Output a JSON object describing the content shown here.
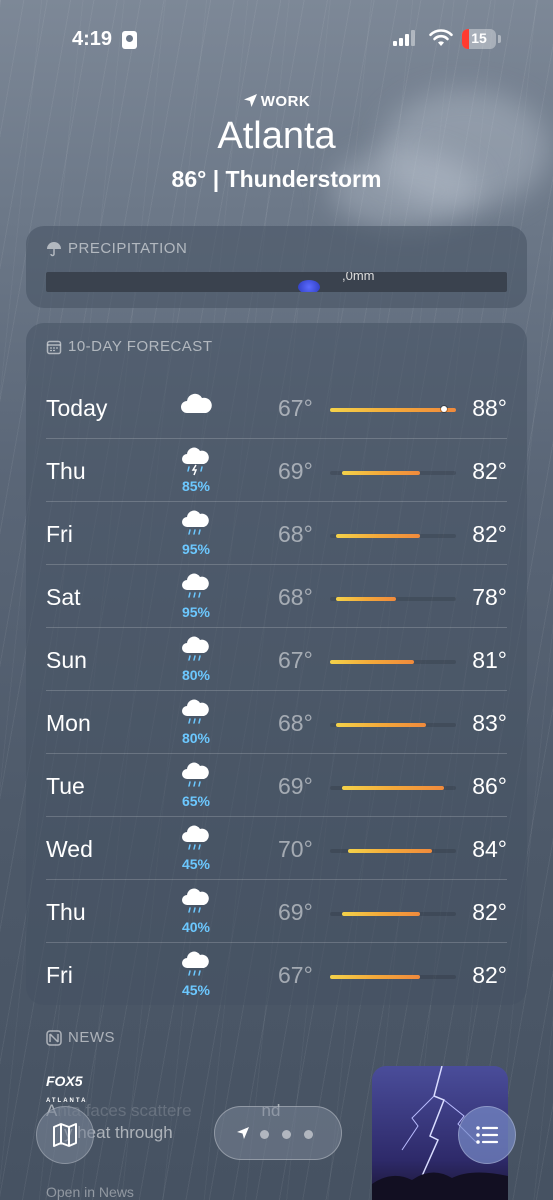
{
  "status_bar": {
    "time": "4:19",
    "battery": "15"
  },
  "header": {
    "location_tag": "WORK",
    "city": "Atlanta",
    "summary": "86°  |  Thunderstorm"
  },
  "precipitation": {
    "title": "PRECIPITATION",
    "map_label": ",0mm"
  },
  "forecast": {
    "title": "10-DAY FORECAST",
    "days": [
      {
        "day": "Today",
        "icon": "cloud-icon",
        "precip": "",
        "low": "67°",
        "high": "88°",
        "low_val": 67,
        "high_val": 88,
        "current_val": 86
      },
      {
        "day": "Thu",
        "icon": "thunderstorm-rain-icon",
        "precip": "85%",
        "low": "69°",
        "high": "82°",
        "low_val": 69,
        "high_val": 82
      },
      {
        "day": "Fri",
        "icon": "rain-icon",
        "precip": "95%",
        "low": "68°",
        "high": "82°",
        "low_val": 68,
        "high_val": 82
      },
      {
        "day": "Sat",
        "icon": "rain-icon",
        "precip": "95%",
        "low": "68°",
        "high": "78°",
        "low_val": 68,
        "high_val": 78
      },
      {
        "day": "Sun",
        "icon": "rain-icon",
        "precip": "80%",
        "low": "67°",
        "high": "81°",
        "low_val": 67,
        "high_val": 81
      },
      {
        "day": "Mon",
        "icon": "rain-icon",
        "precip": "80%",
        "low": "68°",
        "high": "83°",
        "low_val": 68,
        "high_val": 83
      },
      {
        "day": "Tue",
        "icon": "rain-icon",
        "precip": "65%",
        "low": "69°",
        "high": "86°",
        "low_val": 69,
        "high_val": 86
      },
      {
        "day": "Wed",
        "icon": "rain-icon",
        "precip": "45%",
        "low": "70°",
        "high": "84°",
        "low_val": 70,
        "high_val": 84
      },
      {
        "day": "Thu",
        "icon": "rain-icon",
        "precip": "40%",
        "low": "69°",
        "high": "82°",
        "low_val": 69,
        "high_val": 82
      },
      {
        "day": "Fri",
        "icon": "rain-icon",
        "precip": "45%",
        "low": "67°",
        "high": "82°",
        "low_val": 67,
        "high_val": 82
      }
    ]
  },
  "news": {
    "title": "NEWS",
    "source": "FOX5",
    "source_sub": "ATLANTA",
    "headline_start": "A",
    "headline_mid": "nta faces scattere",
    "headline_end": "nd",
    "headline_line2_start": "",
    "headline_line2": "y heat through",
    "open_in": "Open in News"
  },
  "colors": {
    "precip_text": "#6cc8ff",
    "bar_start": "#f4d24a",
    "bar_end": "#f08a3c"
  }
}
